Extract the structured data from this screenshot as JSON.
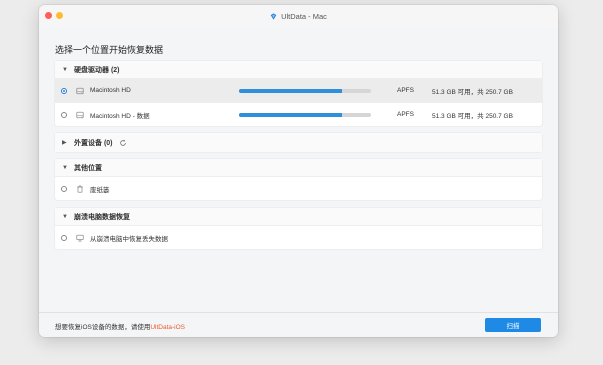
{
  "window": {
    "title": "UltData - Mac"
  },
  "heading": "选择一个位置开始恢复数据",
  "groups": {
    "disks": {
      "label": "硬盘驱动器 (2)",
      "items": [
        {
          "name": "Macintosh HD",
          "fs": "APFS",
          "size": "51.3 GB 可用，共 250.7 GB",
          "usage": 0.78,
          "selected": true
        },
        {
          "name": "Macintosh HD - 数据",
          "fs": "APFS",
          "size": "51.3 GB 可用，共 250.7 GB",
          "usage": 0.78,
          "selected": false
        }
      ]
    },
    "external": {
      "label": "外置设备 (0)"
    },
    "other": {
      "label": "其他位置",
      "items": [
        {
          "name": "废纸篓"
        }
      ]
    },
    "crash": {
      "label": "崩溃电脑数据恢复",
      "items": [
        {
          "name": "从崩溃电脑中恢复丢失数据"
        }
      ]
    }
  },
  "footer": {
    "text": "想要恢复iOS设备的数据，请使用",
    "link": "UltData-iOS",
    "scan_label": "扫描"
  },
  "colors": {
    "accent": "#1e8ae6",
    "link": "#ea5a2a",
    "bar": "#2f8fd8"
  },
  "icons": {
    "app": "ultdata-logo-icon",
    "disk": "hard-drive-icon",
    "trash": "trash-icon",
    "crash": "monitor-icon",
    "refresh": "refresh-icon"
  }
}
